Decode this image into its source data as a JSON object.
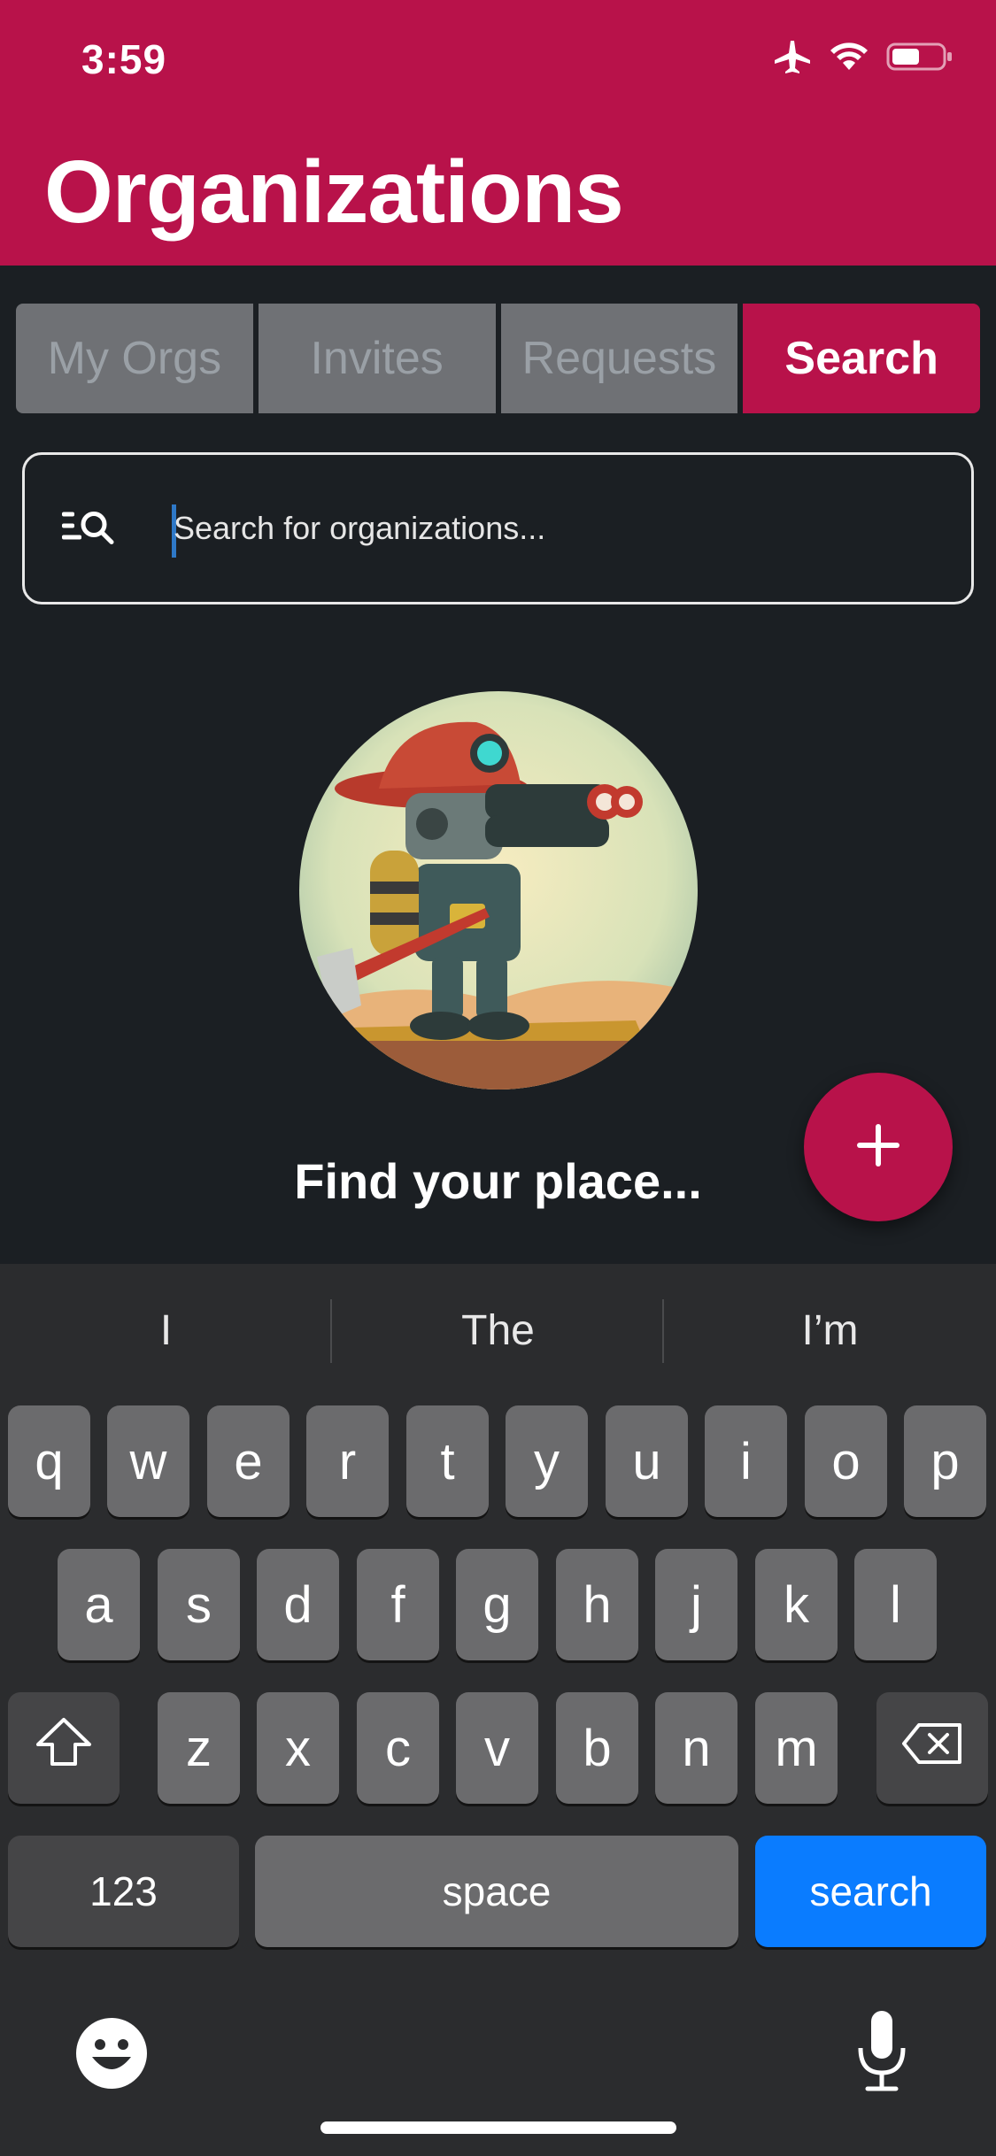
{
  "status_bar": {
    "time": "3:59"
  },
  "header": {
    "title": "Organizations"
  },
  "tabs": [
    {
      "label": "My Orgs"
    },
    {
      "label": "Invites"
    },
    {
      "label": "Requests"
    },
    {
      "label": "Search"
    }
  ],
  "search": {
    "placeholder": "Search for organizations..."
  },
  "empty_state": {
    "text": "Find your place..."
  },
  "keyboard": {
    "suggestions": [
      "I",
      "The",
      "I’m"
    ],
    "row1": [
      "q",
      "w",
      "e",
      "r",
      "t",
      "y",
      "u",
      "i",
      "o",
      "p"
    ],
    "row2": [
      "a",
      "s",
      "d",
      "f",
      "g",
      "h",
      "j",
      "k",
      "l"
    ],
    "row3": [
      "z",
      "x",
      "c",
      "v",
      "b",
      "n",
      "m"
    ],
    "numbers_label": "123",
    "space_label": "space",
    "action_label": "search"
  },
  "colors": {
    "brand": "#b8124a",
    "background": "#1b1f23",
    "keyboard_action": "#0a7cff"
  }
}
